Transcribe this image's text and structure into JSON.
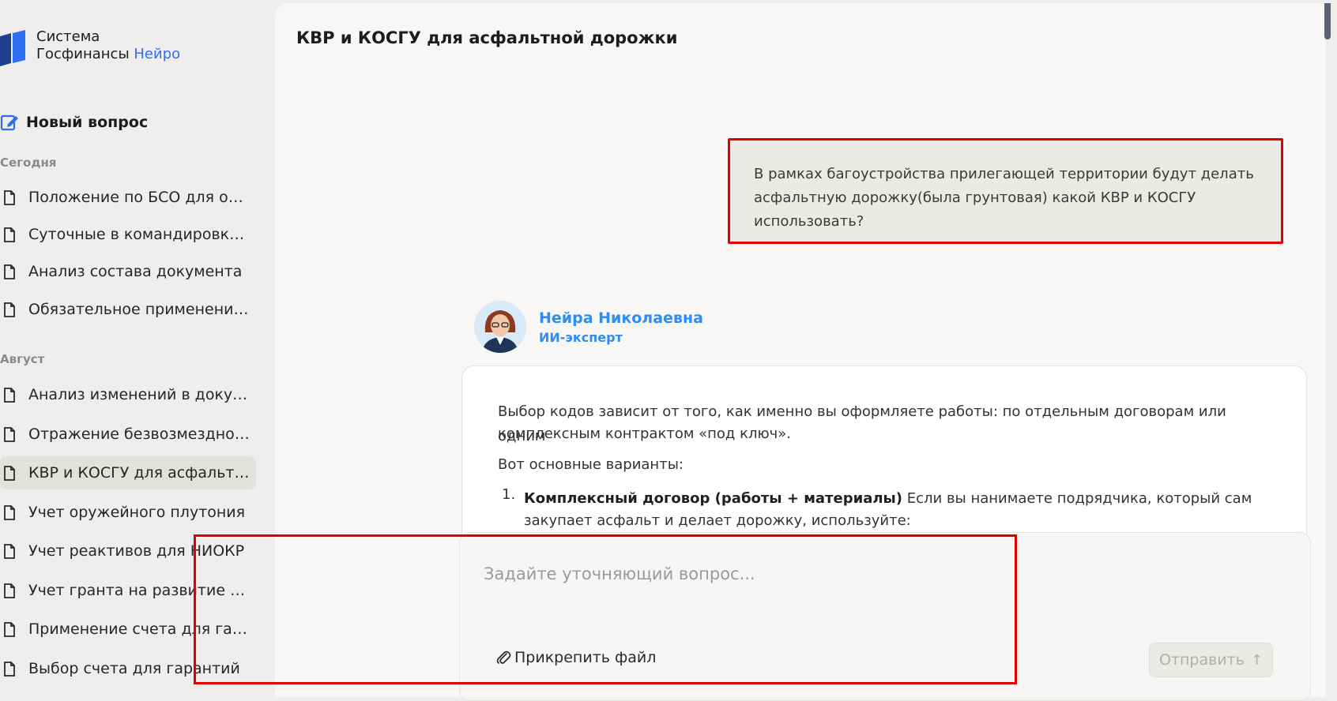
{
  "app": {
    "brand_line1": "Система",
    "brand_line2": "Госфинансы",
    "brand_accent": "Нейро"
  },
  "sidebar": {
    "new_question": "Новый вопрос",
    "section_today": "Сегодня",
    "section_august": "Август",
    "today_items": [
      "Положение по БСО для обр...",
      "Суточные в командировке Т...",
      "Анализ состава документа",
      "Обязательное применение ..."
    ],
    "august_items": [
      "Анализ изменений в докуме...",
      "Отражение безвозмездного...",
      "КВР и КОСГУ для асфальтно...",
      "Учет оружейного плутония",
      "Учет реактивов для НИОКР",
      "Учет гранта на развитие ИИ",
      "Применение счета для гара...",
      "Выбор счета для гарантий"
    ],
    "active_index": 2
  },
  "chat": {
    "title": "КВР и КОСГУ для асфальтной дорожки",
    "user_message_lines": [
      "В рамках багоустройства прилегающей территории будут делать",
      "асфальтную дорожку(была грунтовая) какой КВР и КОСГУ",
      "использовать?"
    ],
    "bot_name": "Нейра Николаевна",
    "bot_role": "ИИ-эксперт",
    "answer_p1_line1": "Выбор кодов зависит от того, как именно вы оформляете работы: по отдельным договорам или одним",
    "answer_p1_line2": "комплексным контрактом «под ключ».",
    "answer_p2": "Вот основные варианты:",
    "answer_li_num": "1.",
    "answer_li_bold": "Комплексный договор (работы + материалы)",
    "answer_li_rest": " Если вы нанимаете подрядчика, который сам",
    "answer_li_line2": "закупает асфальт и делает дорожку, используйте:"
  },
  "composer": {
    "placeholder": "Задайте уточняющий вопрос...",
    "attach_label": "Прикрепить файл",
    "send_label": "Отправить",
    "send_arrow": "↑"
  },
  "colors": {
    "accent_blue": "#2f6df3",
    "bot_blue": "#2f8cf5",
    "highlight_red": "#e00000",
    "sidebar_bg": "#efeeec"
  }
}
